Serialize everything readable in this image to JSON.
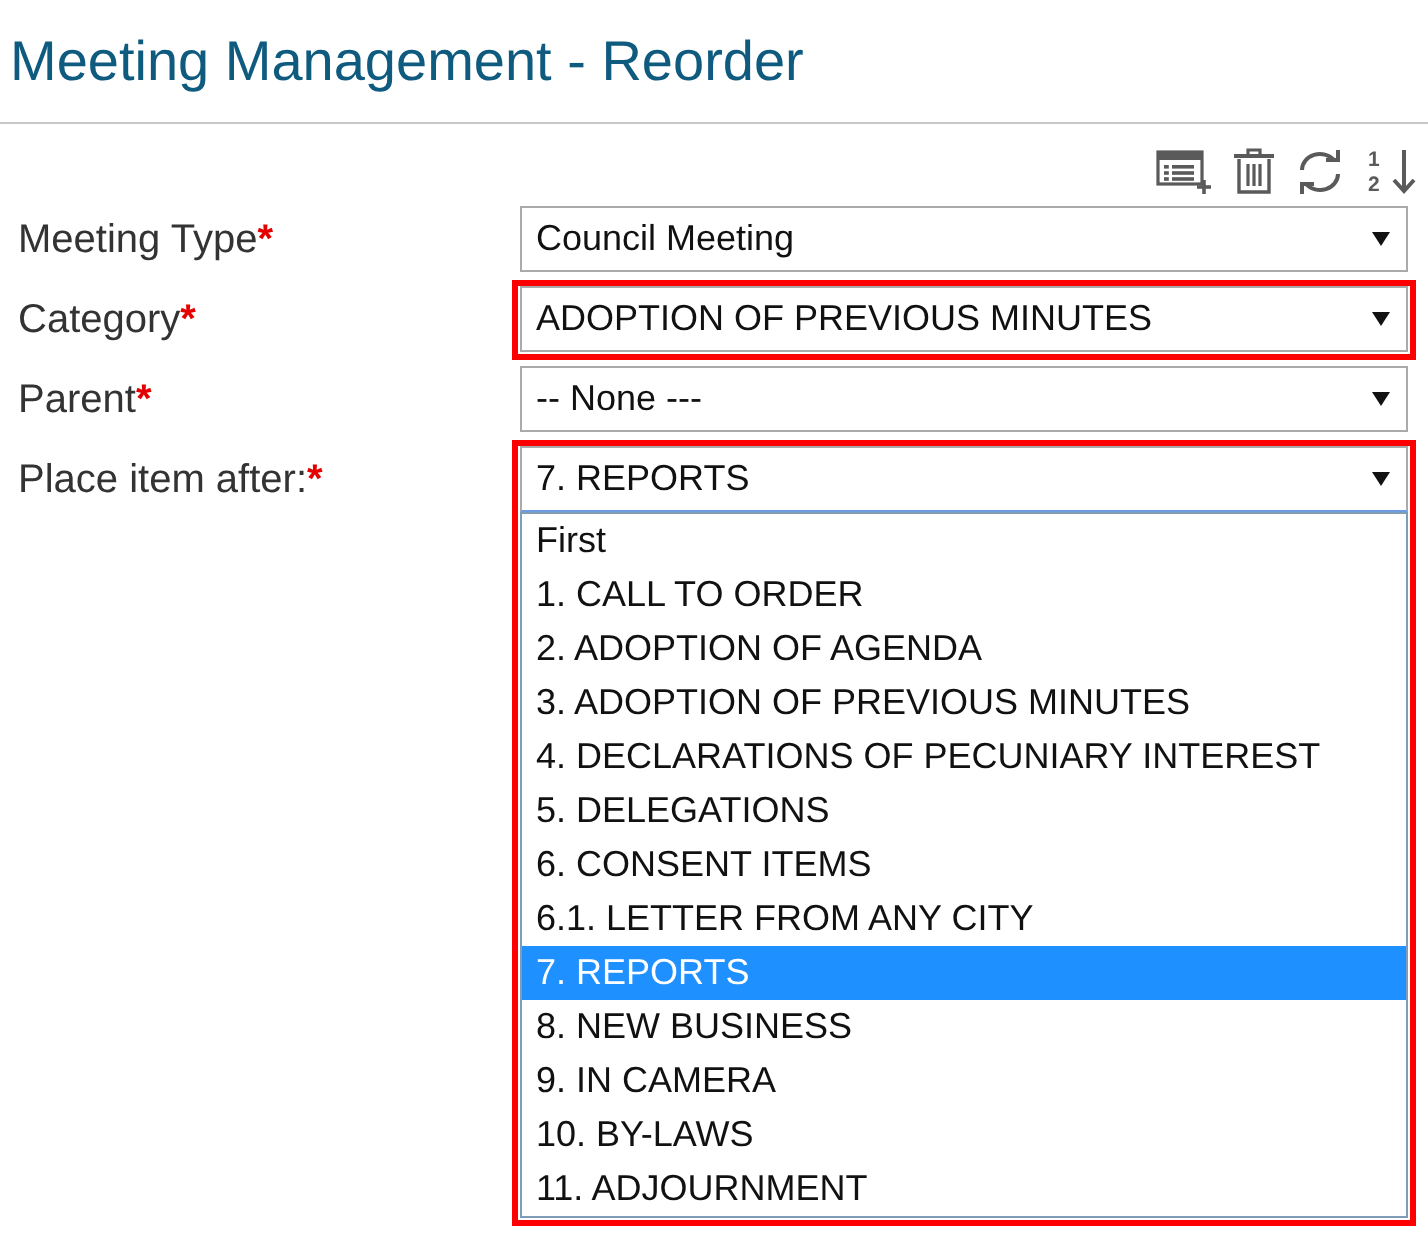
{
  "page": {
    "title": "Meeting Management - Reorder"
  },
  "toolbar": [
    {
      "kind": "add-list"
    },
    {
      "kind": "delete"
    },
    {
      "kind": "refresh"
    },
    {
      "kind": "sort",
      "digits": [
        "1",
        "2"
      ]
    }
  ],
  "fields": [
    {
      "label": "Meeting Type",
      "required_mark": "*",
      "value": "Council Meeting",
      "highlighted": false,
      "expanded": false
    },
    {
      "label": "Category",
      "required_mark": "*",
      "value": "ADOPTION OF PREVIOUS MINUTES",
      "highlighted": true,
      "expanded": false
    },
    {
      "label": "Parent",
      "required_mark": "*",
      "value": "-- None ---",
      "highlighted": false,
      "expanded": false
    },
    {
      "label": "Place item after:",
      "required_mark": "*",
      "value": "7. REPORTS",
      "highlighted": true,
      "expanded": true,
      "options": [
        {
          "label": "First",
          "selected": false
        },
        {
          "label": "1. CALL TO ORDER",
          "selected": false
        },
        {
          "label": "2. ADOPTION OF AGENDA",
          "selected": false
        },
        {
          "label": "3. ADOPTION OF PREVIOUS MINUTES",
          "selected": false
        },
        {
          "label": "4. DECLARATIONS OF PECUNIARY INTEREST",
          "selected": false
        },
        {
          "label": "5. DELEGATIONS",
          "selected": false
        },
        {
          "label": "6. CONSENT ITEMS",
          "selected": false
        },
        {
          "label": "6.1. LETTER FROM ANY CITY",
          "selected": false
        },
        {
          "label": "7. REPORTS",
          "selected": true
        },
        {
          "label": "8. NEW BUSINESS",
          "selected": false
        },
        {
          "label": "9. IN CAMERA",
          "selected": false
        },
        {
          "label": "10. BY-LAWS",
          "selected": false
        },
        {
          "label": "11. ADJOURNMENT",
          "selected": false
        }
      ]
    }
  ]
}
